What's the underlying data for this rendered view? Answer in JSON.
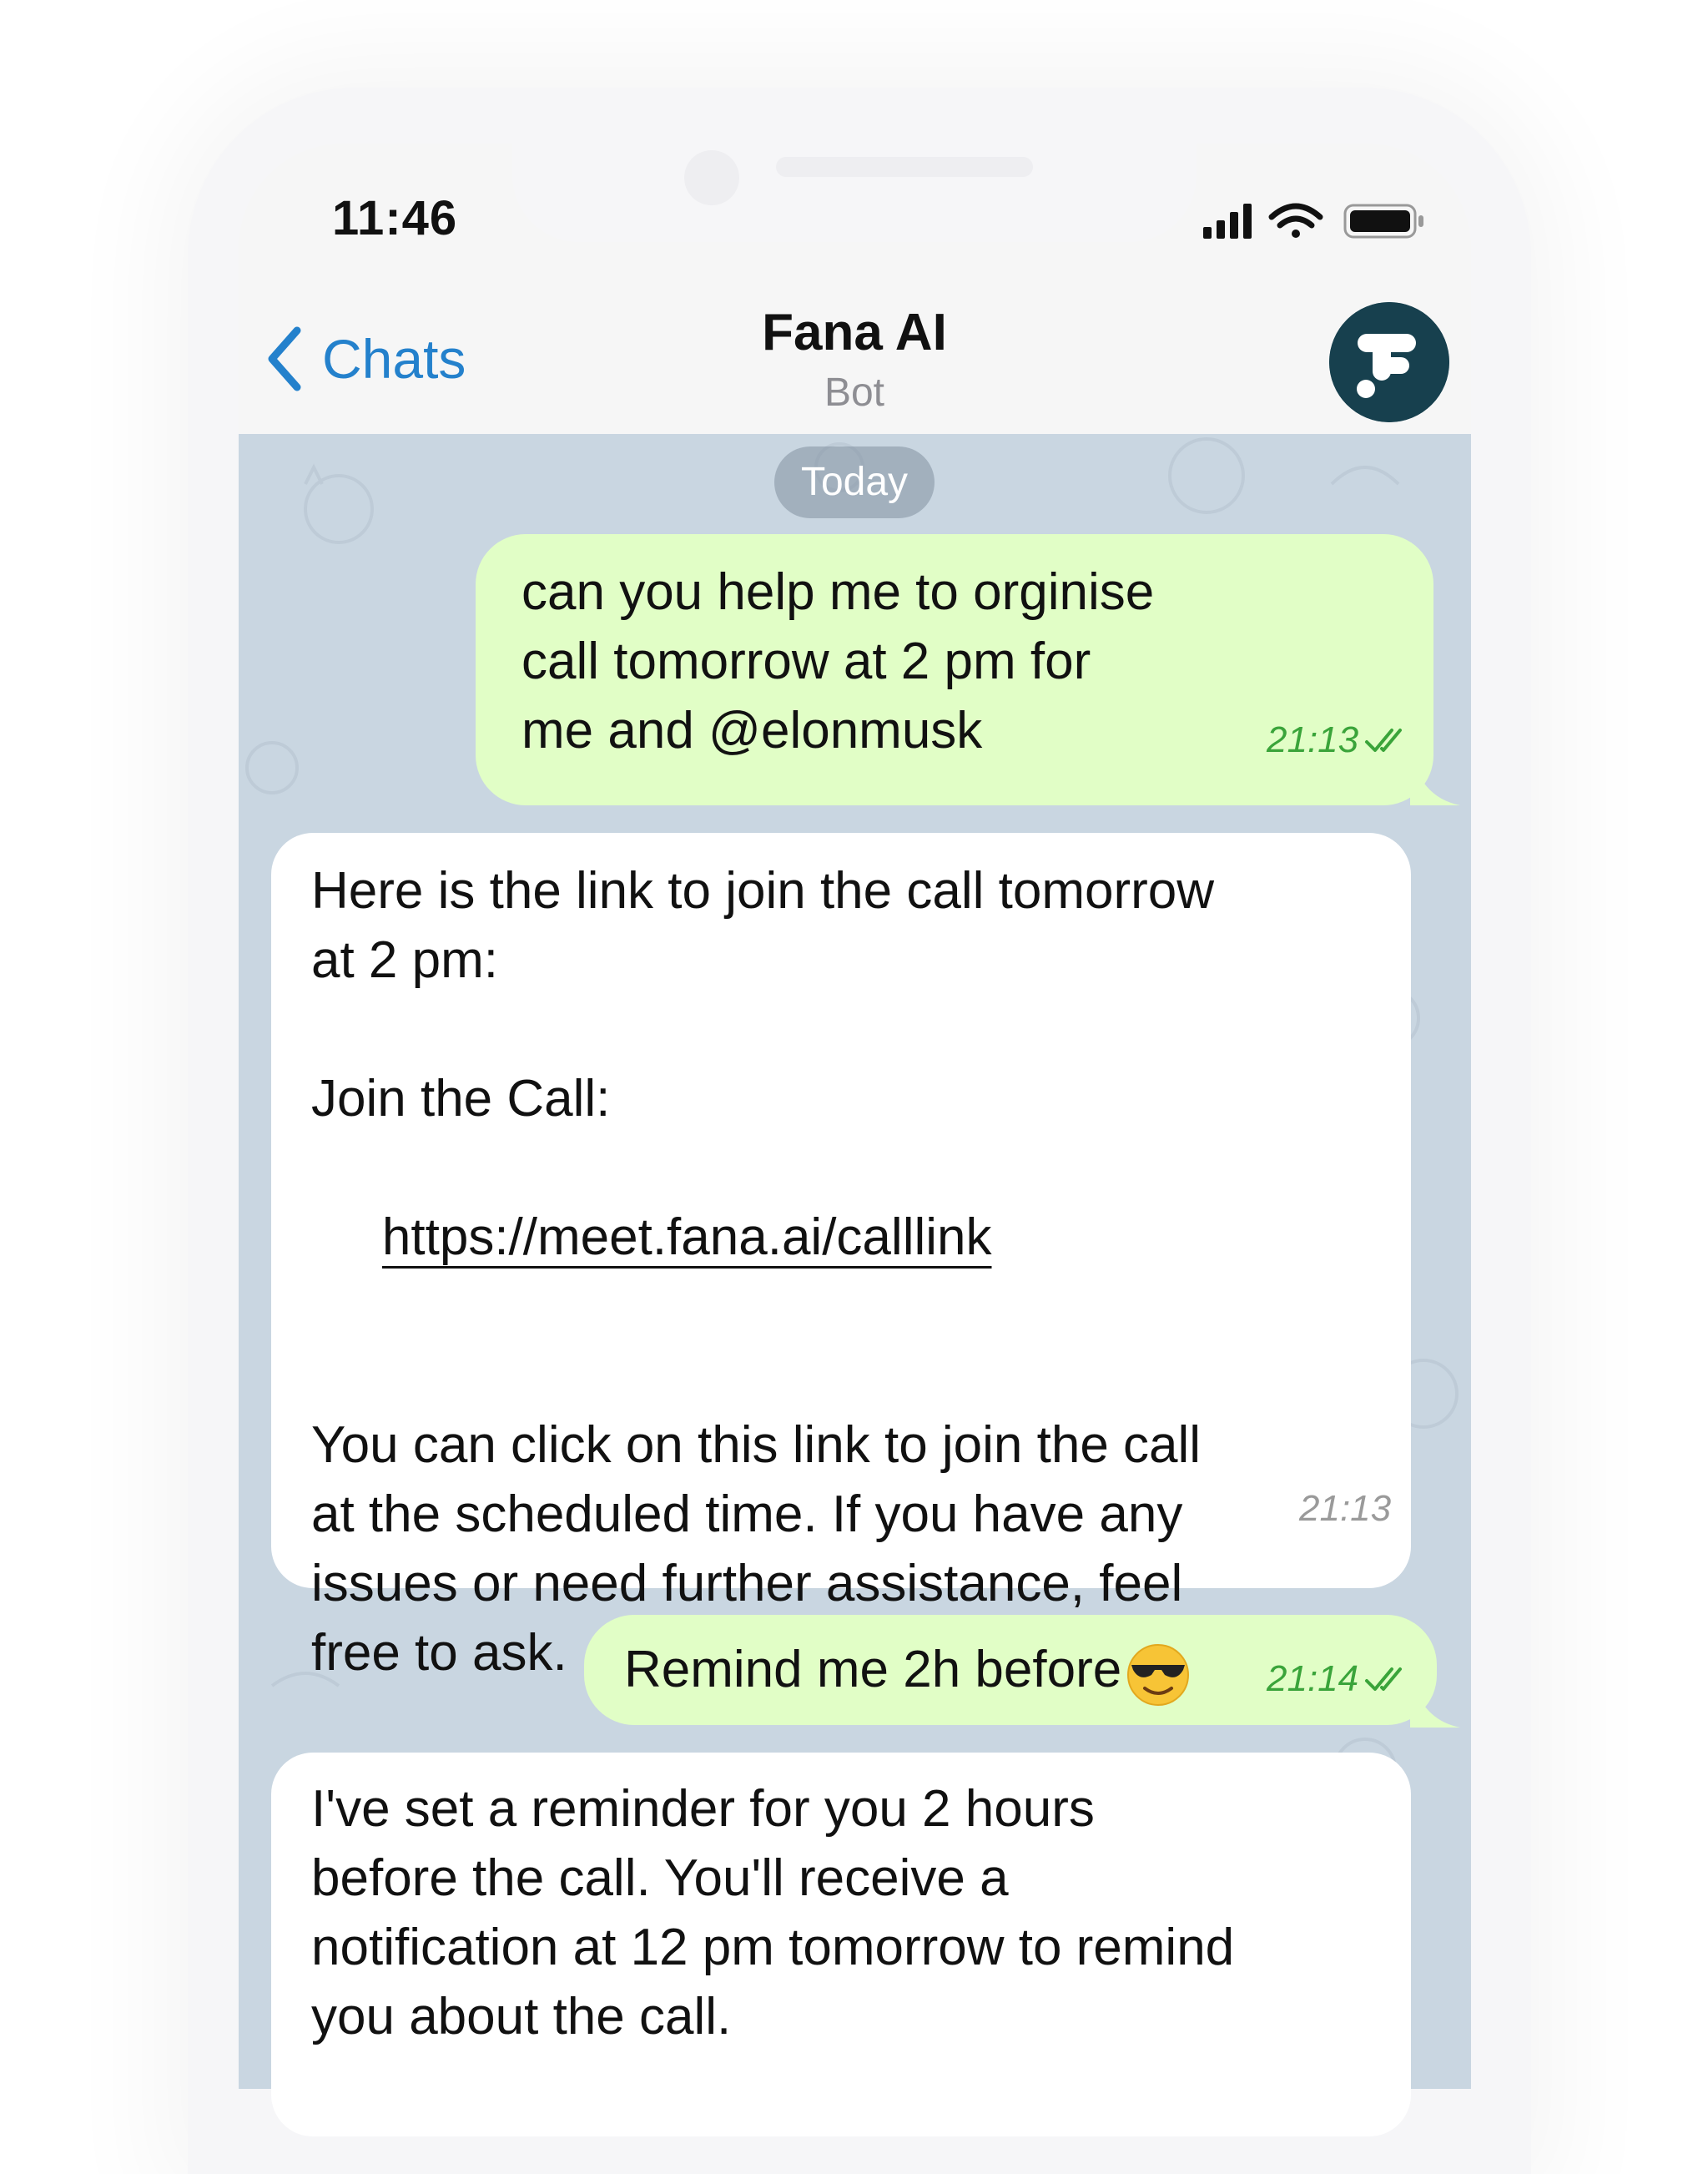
{
  "status_bar": {
    "time": "11:46"
  },
  "header": {
    "back_label": "Chats",
    "title": "Fana AI",
    "subtitle": "Bot"
  },
  "date_separator": "Today",
  "messages": [
    {
      "direction": "out",
      "text": "can you help me to orginise\ncall tomorrow at 2 pm for\nme and @elonmusk",
      "time": "21:13"
    },
    {
      "direction": "in",
      "text_before_link": "Here is the link to join the call tomorrow\nat 2 pm:\n\nJoin the Call:",
      "link": "https://meet.fana.ai/calllink",
      "text_after_link": "You can click on this link to join the call\nat the scheduled time. If you have any\nissues or need further assistance, feel\nfree to ask.",
      "time": "21:13"
    },
    {
      "direction": "out",
      "text": "Remind me 2h before",
      "emoji": "smiling-face-with-sunglasses",
      "time": "21:14"
    },
    {
      "direction": "in",
      "text": "I've set a reminder for you 2 hours\nbefore the call. You'll receive a\nnotification at 12 pm tomorrow to remind\nyou about the call."
    }
  ],
  "colors": {
    "accent": "#2481cc",
    "outgoing_bubble": "#e1fec6",
    "incoming_bubble": "#ffffff",
    "chat_background": "#c9d6e1",
    "read_check": "#3aa43a",
    "avatar_bg": "#17404e"
  }
}
